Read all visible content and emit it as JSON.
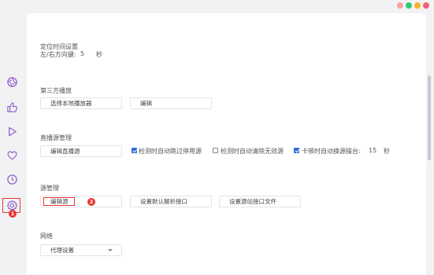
{
  "window": {
    "dot_colors": [
      "#f8a4a4",
      "#2ecc71",
      "#f5b32a",
      "#f0607a"
    ]
  },
  "sidebar": {
    "items": [
      {
        "name": "aperture-icon"
      },
      {
        "name": "thumbs-up-icon"
      },
      {
        "name": "play-icon"
      },
      {
        "name": "heart-icon"
      },
      {
        "name": "clock-icon"
      },
      {
        "name": "gear-icon"
      }
    ],
    "badge": "1",
    "accent": "#e53935"
  },
  "sections": {
    "timing": {
      "title": "定位时间设置",
      "label": "左/右方向键:",
      "value": "5",
      "unit": "秒"
    },
    "player": {
      "title": "第三方播放",
      "select_button": "选择本地播放器",
      "edit_button": "编辑"
    },
    "live": {
      "title": "直播源管理",
      "edit_button": "编辑直播源",
      "options": [
        {
          "label": "检测时自动跳过停用源",
          "checked": true
        },
        {
          "label": "检测时自动清除无效源",
          "checked": false
        },
        {
          "label": "卡顿时自动换源操台:",
          "checked": true
        }
      ],
      "stall_value": "15",
      "stall_unit": "秒"
    },
    "source": {
      "title": "源管理",
      "edit_button": "编辑源",
      "badge": "2",
      "default_button": "设置默认解析接口",
      "site_button": "设置源站接口文件"
    },
    "network": {
      "title": "网络",
      "proxy_select": "代理设置"
    }
  }
}
